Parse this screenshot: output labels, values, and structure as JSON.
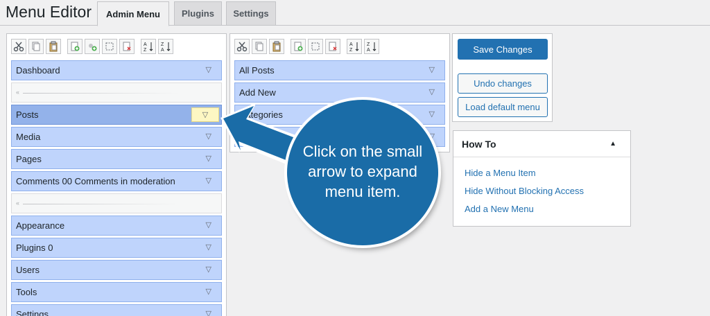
{
  "page": {
    "title": "Menu Editor"
  },
  "tabs": [
    {
      "label": "Admin Menu"
    },
    {
      "label": "Plugins"
    },
    {
      "label": "Settings"
    }
  ],
  "toolbar_icons": [
    "cut-icon",
    "copy-icon",
    "paste-icon",
    "new-item-icon",
    "new-separator-icon",
    "hide-icon",
    "delete-icon",
    "sort-ascending-icon",
    "sort-descending-icon"
  ],
  "left_menu": {
    "items": [
      {
        "label": "Dashboard"
      },
      {
        "label": "Posts"
      },
      {
        "label": "Media"
      },
      {
        "label": "Pages"
      },
      {
        "label": "Comments 00 Comments in moderation"
      },
      {
        "label": "Appearance"
      },
      {
        "label": "Plugins 0"
      },
      {
        "label": "Users"
      },
      {
        "label": "Tools"
      },
      {
        "label": "Settings"
      }
    ]
  },
  "sub_menu": {
    "items": [
      {
        "label": "All Posts"
      },
      {
        "label": "Add New"
      },
      {
        "label": "Categories"
      },
      {
        "label": "Tags"
      }
    ],
    "visible_label_fragment": "tegories"
  },
  "actions": {
    "save": "Save Changes",
    "undo": "Undo changes",
    "load_default": "Load default menu"
  },
  "howto": {
    "title": "How To",
    "links": [
      {
        "label": "Hide a Menu Item"
      },
      {
        "label": "Hide Without Blocking Access"
      },
      {
        "label": "Add a New Menu"
      }
    ]
  },
  "callout": {
    "line1": "Click on the small",
    "line2": "arrow to expand",
    "line3": "menu item."
  },
  "colors": {
    "item_bg": "#bfd4fc",
    "item_selected_bg": "#93b2ea",
    "primary": "#2271b1",
    "callout": "#1a6ca7",
    "arrow_highlight": "#fdf7c3"
  }
}
